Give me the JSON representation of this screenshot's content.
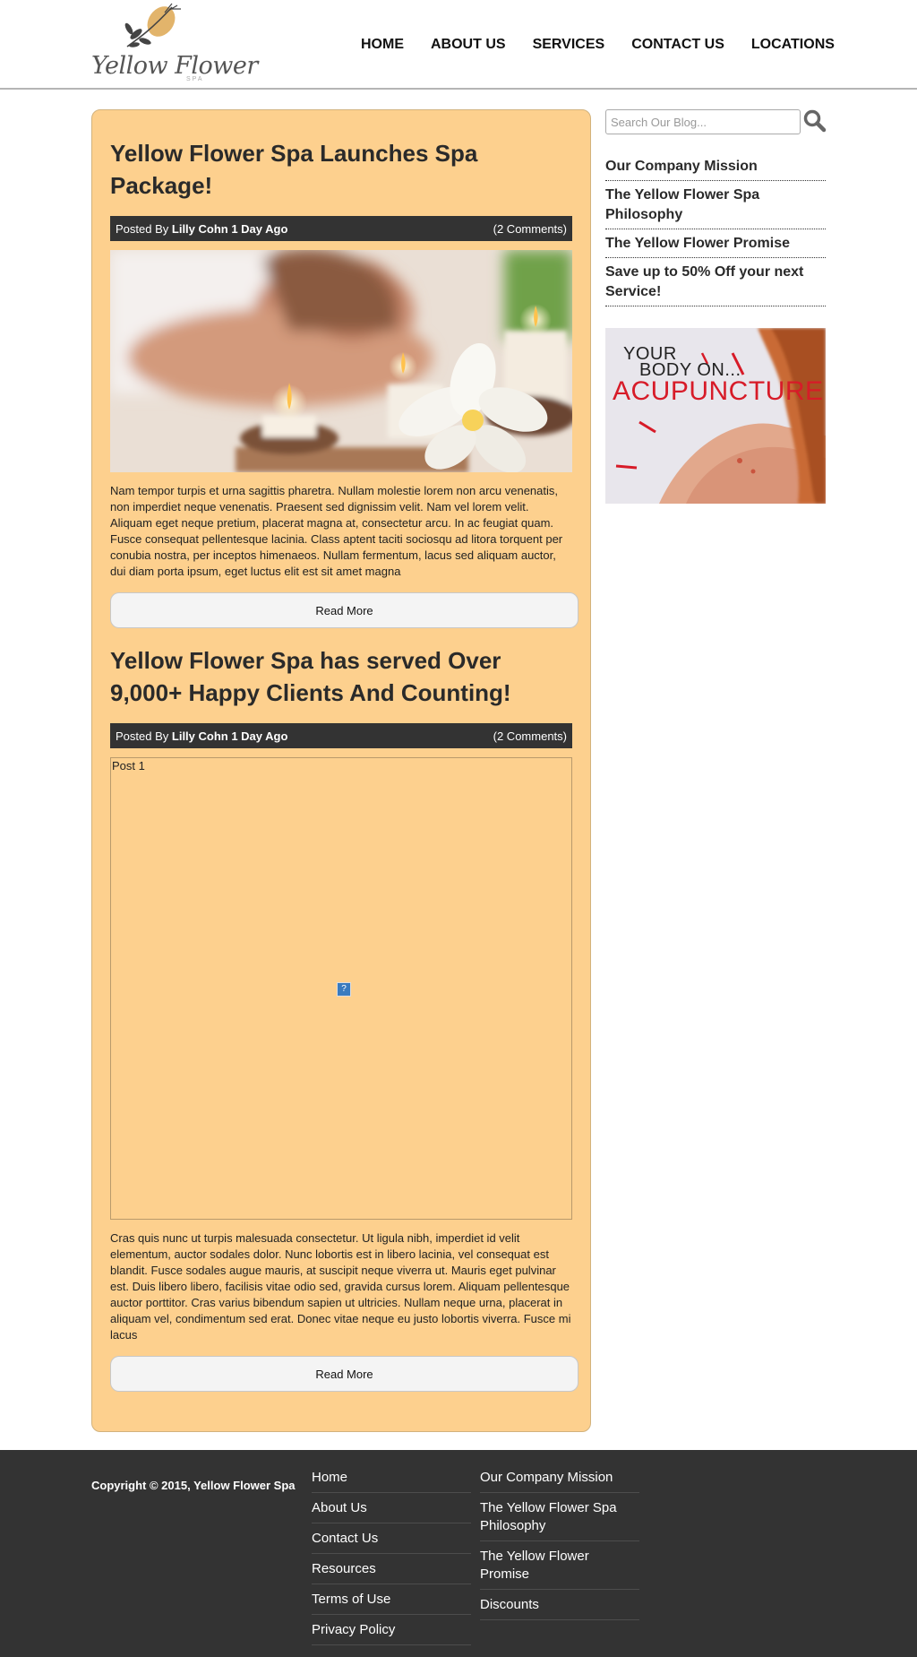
{
  "header": {
    "logo_text": "Yellow Flower",
    "logo_sub": "SPA",
    "nav": [
      "HOME",
      "ABOUT US",
      "SERVICES",
      "CONTACT US",
      "LOCATIONS"
    ]
  },
  "posts": [
    {
      "title": "Yellow Flower Spa Launches Spa Package!",
      "meta_prefix": "Posted By",
      "meta_author": "Lilly Cohn 1 Day Ago",
      "comments": "(2 Comments)",
      "body": "Nam tempor turpis et urna sagittis pharetra. Nullam molestie lorem non arcu venenatis, non imperdiet neque venenatis. Praesent sed dignissim velit. Nam vel lorem velit. Aliquam eget neque pretium, placerat magna at, consectetur arcu. In ac feugiat quam. Fusce consequat pellentesque lacinia. Class aptent taciti sociosqu ad litora torquent per conubia nostra, per inceptos himenaeos. Nullam fermentum, lacus sed aliquam auctor, dui diam porta ipsum, eget luctus elit est sit amet magna",
      "read_more": "Read More"
    },
    {
      "title": "Yellow Flower Spa has served Over 9,000+ Happy Clients And Counting!",
      "meta_prefix": "Posted By",
      "meta_author": "Lilly Cohn 1 Day Ago",
      "comments": "(2 Comments)",
      "image_alt": "Post 1",
      "broken_icon": "?",
      "body": "Cras quis nunc ut turpis malesuada consectetur. Ut ligula nibh, imperdiet id velit elementum, auctor sodales dolor. Nunc lobortis est in libero lacinia, vel consequat est blandit. Fusce sodales augue mauris, at suscipit neque viverra ut. Mauris eget pulvinar est. Duis libero libero, facilisis vitae odio sed, gravida cursus lorem. Aliquam pellentesque auctor porttitor. Cras varius bibendum sapien ut ultricies. Nullam neque urna, placerat in aliquam vel, condimentum sed erat. Donec vitae neque eu justo lobortis viverra. Fusce mi lacus",
      "read_more": "Read More"
    }
  ],
  "sidebar": {
    "search_placeholder": "Search Our Blog...",
    "links": [
      "Our Company Mission",
      "The Yellow Flower Spa Philosophy",
      "The Yellow Flower Promise",
      "Save up to 50% Off your next Service!"
    ],
    "ad": {
      "line1": "YOUR",
      "line2": "BODY ON...",
      "line3": "ACUPUNCTURE"
    }
  },
  "footer": {
    "copyright": "Copyright © 2015, Yellow Flower Spa",
    "col1": [
      "Home",
      "About Us",
      "Contact Us",
      "Resources",
      "Terms of Use",
      "Privacy Policy"
    ],
    "col2": [
      "Our Company Mission",
      "The Yellow Flower Spa Philosophy",
      "The Yellow Flower Promise",
      "Discounts"
    ]
  },
  "colors": {
    "main_bg": "#fdd08e",
    "meta_bar": "#333333",
    "footer_bg": "#333333",
    "ad_accent": "#d71b28"
  }
}
